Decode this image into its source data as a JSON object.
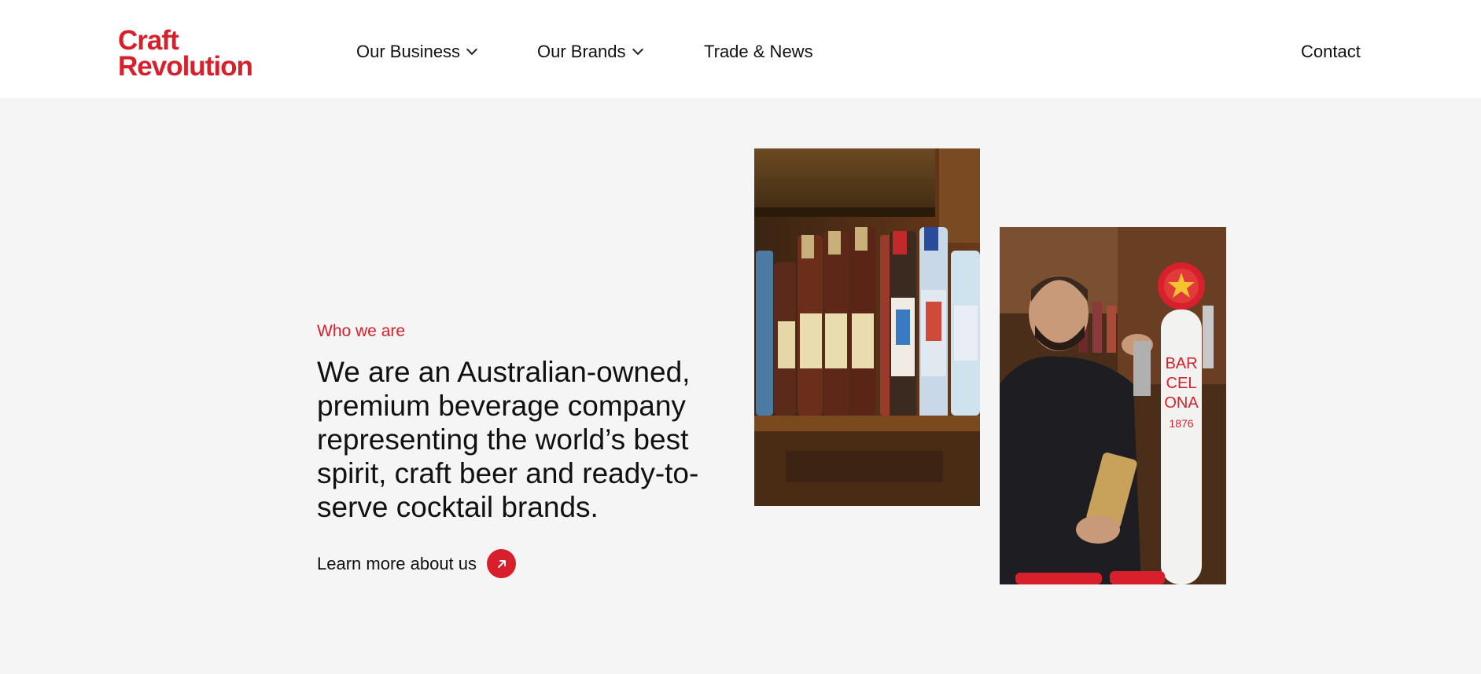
{
  "header": {
    "logo_line1": "Craft",
    "logo_line2": "Revolution",
    "nav": [
      {
        "label": "Our Business",
        "has_dropdown": true
      },
      {
        "label": "Our Brands",
        "has_dropdown": true
      },
      {
        "label": "Trade & News",
        "has_dropdown": false
      }
    ],
    "contact_label": "Contact"
  },
  "intro": {
    "eyebrow": "Who we are",
    "headline": "We are an Australian-owned, premium beverage company representing the world’s best spirit, craft beer and ready-to-serve cocktail brands.",
    "cta_label": "Learn more about us",
    "cta_icon": "arrow-up-right-icon"
  },
  "images": {
    "left": "bottles-on-bar-shelf",
    "right": "bartender-pouring-beer-tap"
  },
  "colors": {
    "accent": "#d7202b",
    "background": "#f5f5f5",
    "header_bg": "#ffffff",
    "text": "#111111"
  }
}
